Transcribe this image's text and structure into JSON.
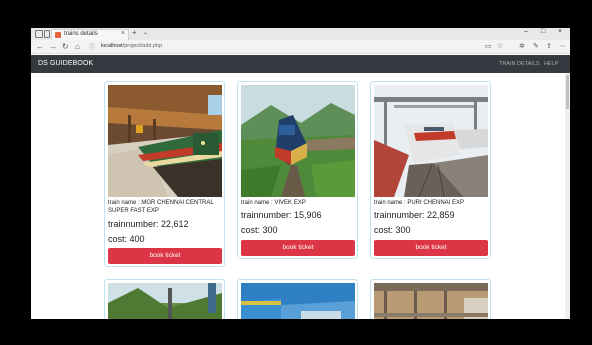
{
  "browser": {
    "tab_title": "trains details",
    "tab_close": "×",
    "new_tab": "+",
    "tab_menu": "⌄",
    "window_buttons": [
      "–",
      "□",
      "×"
    ],
    "url_host": "localhost",
    "url_path": "/project/add.php"
  },
  "navbar": {
    "brand": "DS GUIDEBOOK",
    "links": [
      "TRAIN DETAILS",
      "HELP"
    ]
  },
  "trains": [
    {
      "name": "train name : MGR CHENNAI CENTRAL SUPER FAST EXP",
      "number": "trainnumber: 22,612",
      "cost": "cost: 400",
      "button": "book ticket"
    },
    {
      "name": "train name : VIVEK EXP",
      "number": "trainnumber: 15,906",
      "cost": "cost: 300",
      "button": "book ticket"
    },
    {
      "name": "train name : PURI CHENNAI EXP",
      "number": "trainnumber: 22,859",
      "cost": "cost: 300",
      "button": "book ticket"
    }
  ],
  "colors": {
    "navbar": "#343a40",
    "button": "#dc3545",
    "card_border": "#bfe3ee"
  }
}
